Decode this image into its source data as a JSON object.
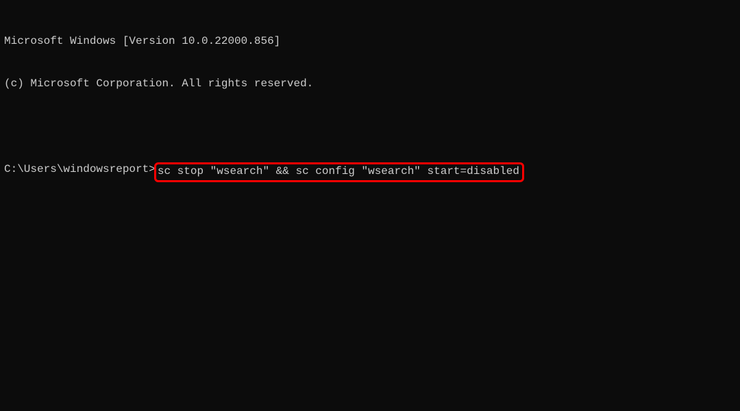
{
  "terminal": {
    "header_line1": "Microsoft Windows [Version 10.0.22000.856]",
    "header_line2": "(c) Microsoft Corporation. All rights reserved.",
    "prompt": "C:\\Users\\windowsreport>",
    "command": "sc stop \"wsearch\" && sc config \"wsearch\" start=disabled",
    "highlight_color": "#ff0000"
  }
}
